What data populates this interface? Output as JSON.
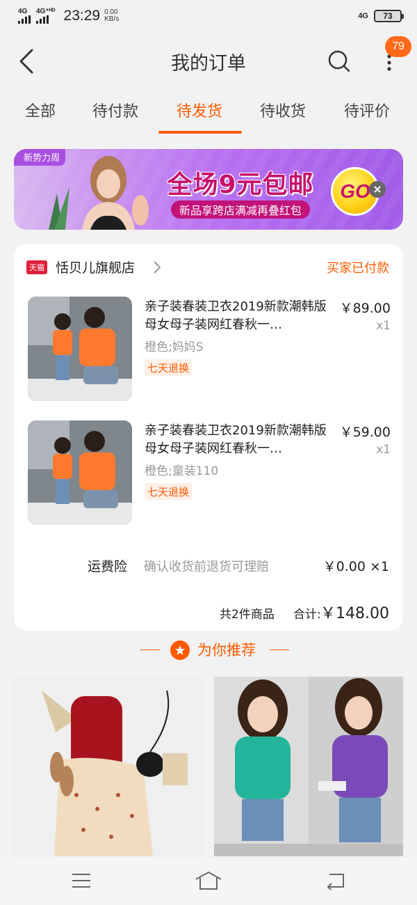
{
  "status_bar": {
    "signal1": "4G",
    "signal2": "4G⁺ᴴᴰ",
    "time": "23:29",
    "speed_value": "0.00",
    "speed_unit": "KB/s",
    "network": "4G",
    "battery": "73"
  },
  "nav": {
    "title": "我的订单",
    "badge_count": "79"
  },
  "tabs": [
    {
      "label": "全部",
      "active": false
    },
    {
      "label": "待付款",
      "active": false
    },
    {
      "label": "待发货",
      "active": true
    },
    {
      "label": "待收货",
      "active": false
    },
    {
      "label": "待评价",
      "active": false
    }
  ],
  "banner": {
    "tag": "新势力周",
    "main_text": "全场9元包邮",
    "sub_text": "新品享跨店满减再叠红包",
    "go_label": "GO"
  },
  "order": {
    "shop_badge": "天猫",
    "shop_name": "恬贝儿旗舰店",
    "status": "买家已付款",
    "items": [
      {
        "title": "亲子装春装卫衣2019新款潮韩版母女母子装网红春秋一…",
        "sku": "橙色;妈妈S",
        "tag": "七天退换",
        "price": "￥89.00",
        "qty": "x1"
      },
      {
        "title": "亲子装春装卫衣2019新款潮韩版母女母子装网红春秋一…",
        "sku": "橙色;童装110",
        "tag": "七天退换",
        "price": "￥59.00",
        "qty": "x1"
      }
    ],
    "insurance": {
      "label": "运费险",
      "desc": "确认收货前退货可理赔",
      "price": "￥0.00 ×1"
    },
    "total": {
      "count": "共2件商品",
      "label": "合计:",
      "amount": "￥148.00"
    }
  },
  "recommend": {
    "title": "为你推荐"
  },
  "colors": {
    "accent": "#ff5a00",
    "badge": "#ff6a1a",
    "tmall_red": "#e0203a",
    "background": "#f2f2f2"
  }
}
